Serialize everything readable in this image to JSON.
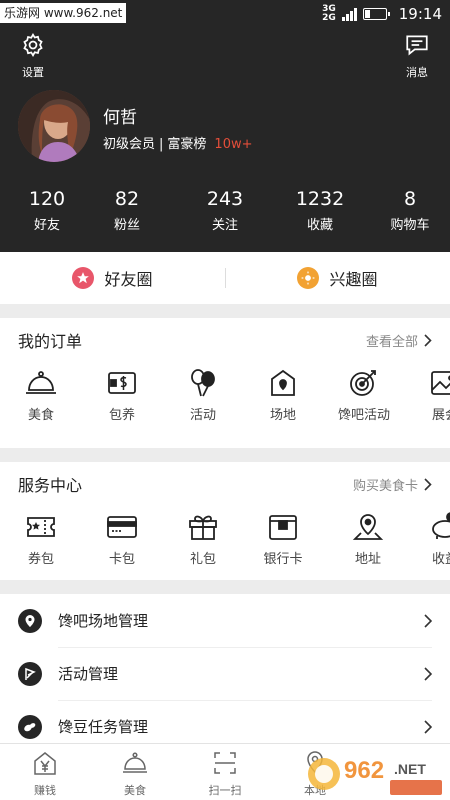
{
  "statusbar": {
    "watermark": "乐游网 www.962.net",
    "network": "3G",
    "network2": "2G",
    "battery_level": 0.25,
    "time": "19:14"
  },
  "header": {
    "settings_label": "设置",
    "messages_label": "消息"
  },
  "profile": {
    "name": "何哲",
    "level": "初级会员",
    "rank": "富豪榜",
    "points": "10w+"
  },
  "stats": [
    {
      "num": "120",
      "label": "好友"
    },
    {
      "num": "82",
      "label": "粉丝"
    },
    {
      "num": "243",
      "label": "关注"
    },
    {
      "num": "1232",
      "label": "收藏"
    },
    {
      "num": "8",
      "label": "购物车"
    }
  ],
  "circles": {
    "friends": "好友圈",
    "interest": "兴趣圈"
  },
  "orders": {
    "title": "我的订单",
    "more": "查看全部",
    "items": [
      {
        "label": "美食",
        "icon": "cloche-icon"
      },
      {
        "label": "包养",
        "icon": "money-ticket-icon"
      },
      {
        "label": "活动",
        "icon": "balloons-icon"
      },
      {
        "label": "场地",
        "icon": "location-home-icon"
      },
      {
        "label": "馋吧活动",
        "icon": "target-icon"
      },
      {
        "label": "展会",
        "icon": "picture-icon"
      }
    ]
  },
  "services": {
    "title": "服务中心",
    "more": "购买美食卡",
    "items": [
      {
        "label": "券包",
        "icon": "coupon-icon"
      },
      {
        "label": "卡包",
        "icon": "card-icon"
      },
      {
        "label": "礼包",
        "icon": "gift-icon"
      },
      {
        "label": "银行卡",
        "icon": "bank-card-icon"
      },
      {
        "label": "地址",
        "icon": "map-pin-icon"
      },
      {
        "label": "收益",
        "icon": "piggy-bank-icon"
      }
    ]
  },
  "menu": [
    {
      "label": "馋吧场地管理",
      "icon": "location-icon"
    },
    {
      "label": "活动管理",
      "icon": "flag-icon"
    },
    {
      "label": "馋豆任务管理",
      "icon": "beans-icon"
    }
  ],
  "nav": [
    {
      "label": "赚钱",
      "icon": "house-yen-icon"
    },
    {
      "label": "美食",
      "icon": "cloche-icon"
    },
    {
      "label": "扫一扫",
      "icon": "scan-icon"
    },
    {
      "label": "本地",
      "icon": "pin-icon"
    }
  ],
  "colors": {
    "header_bg": "#262626",
    "points": "#e34e3a",
    "friends_badge": "#e8566a",
    "interest_badge": "#f2a233"
  }
}
